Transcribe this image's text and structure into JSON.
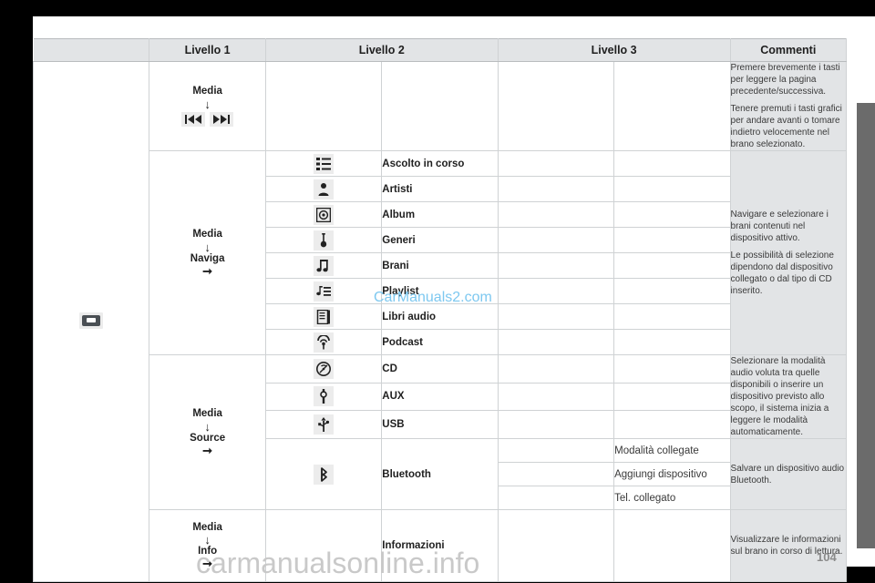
{
  "document": {
    "watermark_inline": "CarManuals2.com",
    "watermark_bottom": "carmanualsonline.info",
    "page_number": "104",
    "accent_watermark_color": "#7dc8f0",
    "header_bg": "#e2e4e6",
    "comment_bg": "#e2e4e6"
  },
  "table": {
    "headers": {
      "level1": "Livello 1",
      "level2": "Livello 2",
      "level3": "Livello 3",
      "comments": "Commenti"
    },
    "left_icon": "car-radio-icon",
    "groups": [
      {
        "level1": {
          "title": "Media",
          "arrow_down": "↓",
          "sub": "",
          "arrow_right": ""
        },
        "buttons": [
          "prev-track-icon",
          "next-track-icon"
        ],
        "rows": [],
        "comments": [
          "Premere brevemente i tasti per leggere la pagina precedente/successiva.",
          "Tenere premuti i tasti grafici per andare avanti o tomare indietro velocemente nel brano selezionato."
        ]
      },
      {
        "level1": {
          "title": "Media",
          "arrow_down": "↓",
          "sub": "Naviga",
          "arrow_right": "➞"
        },
        "rows": [
          {
            "icon": "list-icon",
            "label": "Ascolto in corso",
            "level3": ""
          },
          {
            "icon": "artist-icon",
            "label": "Artisti",
            "level3": ""
          },
          {
            "icon": "album-disc-icon",
            "label": "Album",
            "level3": ""
          },
          {
            "icon": "guitar-icon",
            "label": "Generi",
            "level3": ""
          },
          {
            "icon": "music-note-icon",
            "label": "Brani",
            "level3": ""
          },
          {
            "icon": "playlist-icon",
            "label": "Playlist",
            "level3": ""
          },
          {
            "icon": "audiobook-icon",
            "label": "Libri audio",
            "level3": ""
          },
          {
            "icon": "podcast-icon",
            "label": "Podcast",
            "level3": ""
          }
        ],
        "comments": [
          "Navigare e selezionare i brani contenuti nel dispositivo attivo.",
          "Le possibilità di selezione dipendono dal dispositivo collegato o dal tipo di CD inserito."
        ]
      },
      {
        "level1": {
          "title": "Media",
          "arrow_down": "↓",
          "sub": "Source",
          "arrow_right": "➞"
        },
        "rows": [
          {
            "icon": "cd-icon",
            "label": "CD",
            "level3": ""
          },
          {
            "icon": "aux-jack-icon",
            "label": "AUX",
            "level3": ""
          },
          {
            "icon": "usb-icon",
            "label": "USB",
            "level3": ""
          }
        ],
        "comments": [
          "Selezionare la modalità audio voluta tra quelle disponibili o inserire un dispositivo previsto allo scopo, il sistema inizia a leggere le modalità automaticamente."
        ]
      },
      {
        "level1": {
          "title": "",
          "arrow_down": "",
          "sub": "",
          "arrow_right": ""
        },
        "rows": [
          {
            "icon": "bluetooth-icon",
            "label": "Bluetooth",
            "level3_items": [
              "Modalità collegate",
              "Aggiungi dispositivo",
              "Tel. collegato"
            ]
          }
        ],
        "comments": [
          "Salvare un dispositivo audio Bluetooth."
        ]
      },
      {
        "level1": {
          "title": "Media",
          "arrow_down": "↓",
          "sub": "Info",
          "arrow_right": "➞"
        },
        "rows": [
          {
            "icon": "",
            "label": "Informazioni",
            "level3": ""
          }
        ],
        "comments": [
          "Visualizzare le informazioni sul brano in corso di lettura."
        ]
      }
    ]
  }
}
